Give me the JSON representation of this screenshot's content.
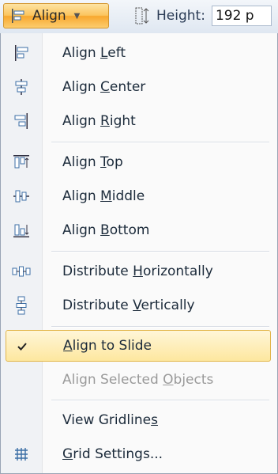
{
  "ribbon": {
    "align_label": "Align",
    "height_label": "Height:",
    "height_value": "192 p"
  },
  "menu": {
    "items": [
      {
        "pre": "Align ",
        "key": "L",
        "post": "eft"
      },
      {
        "pre": "Align ",
        "key": "C",
        "post": "enter"
      },
      {
        "pre": "Align ",
        "key": "R",
        "post": "ight"
      },
      {
        "pre": "Align ",
        "key": "T",
        "post": "op"
      },
      {
        "pre": "Align ",
        "key": "M",
        "post": "iddle"
      },
      {
        "pre": "Align ",
        "key": "B",
        "post": "ottom"
      },
      {
        "pre": "Distribute ",
        "key": "H",
        "post": "orizontally"
      },
      {
        "pre": "Distribute ",
        "key": "V",
        "post": "ertically"
      },
      {
        "pre": "",
        "key": "A",
        "post": "lign to Slide"
      },
      {
        "pre": "Align Selected ",
        "key": "O",
        "post": "bjects"
      },
      {
        "pre": "View Gridline",
        "key": "s",
        "post": ""
      },
      {
        "pre": "",
        "key": "G",
        "post": "rid Settings..."
      }
    ]
  },
  "colors": {
    "accent_button": "#fbc55f",
    "check_highlight": "#fde79f",
    "disabled_text": "#9a9a9a"
  }
}
